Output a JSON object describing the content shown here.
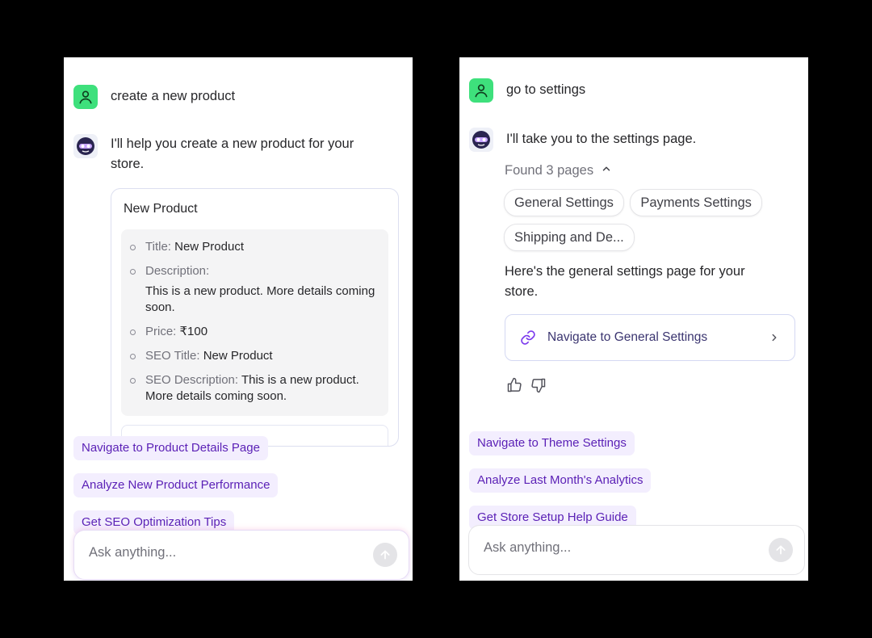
{
  "left": {
    "user_message": "create a new product",
    "bot_message": "I'll help you create a new product for your store.",
    "card": {
      "title": "New Product",
      "fields": {
        "title_label": "Title:",
        "title_value": "New Product",
        "description_label": "Description:",
        "description_value": "This is a new product. More details coming soon.",
        "price_label": "Price:",
        "price_value": "₹100",
        "seo_title_label": "SEO Title:",
        "seo_title_value": "New Product",
        "seo_description_label": "SEO Description:",
        "seo_description_value": "This is a new product. More details coming soon."
      }
    },
    "suggestions": [
      "Navigate to Product Details Page",
      "Analyze New Product Performance",
      "Get SEO Optimization Tips"
    ],
    "input_placeholder": "Ask anything..."
  },
  "right": {
    "user_message": "go to settings",
    "bot_message": "I'll take you to the settings page.",
    "found_label": "Found 3 pages",
    "pages": [
      "General Settings",
      "Payments Settings",
      "Shipping and De..."
    ],
    "followup_message": "Here's the general settings page for your store.",
    "nav_card_label": "Navigate to General Settings",
    "suggestions": [
      "Navigate to Theme Settings",
      "Analyze Last Month's Analytics",
      "Get Store Setup Help Guide"
    ],
    "input_placeholder": "Ask anything..."
  },
  "colors": {
    "user_avatar": "#3ee07c",
    "suggestion_bg": "#f3eefe",
    "suggestion_text": "#5b21b6",
    "link_icon": "#7c3aed"
  },
  "icons": {
    "user_avatar": "user-icon",
    "bot_avatar": "bot-mask-icon",
    "send": "arrow-up-icon",
    "found_toggle": "chevron-up-icon",
    "nav_link": "link-icon",
    "nav_chevron": "chevron-right-icon",
    "like": "thumbs-up-icon",
    "dislike": "thumbs-down-icon"
  }
}
